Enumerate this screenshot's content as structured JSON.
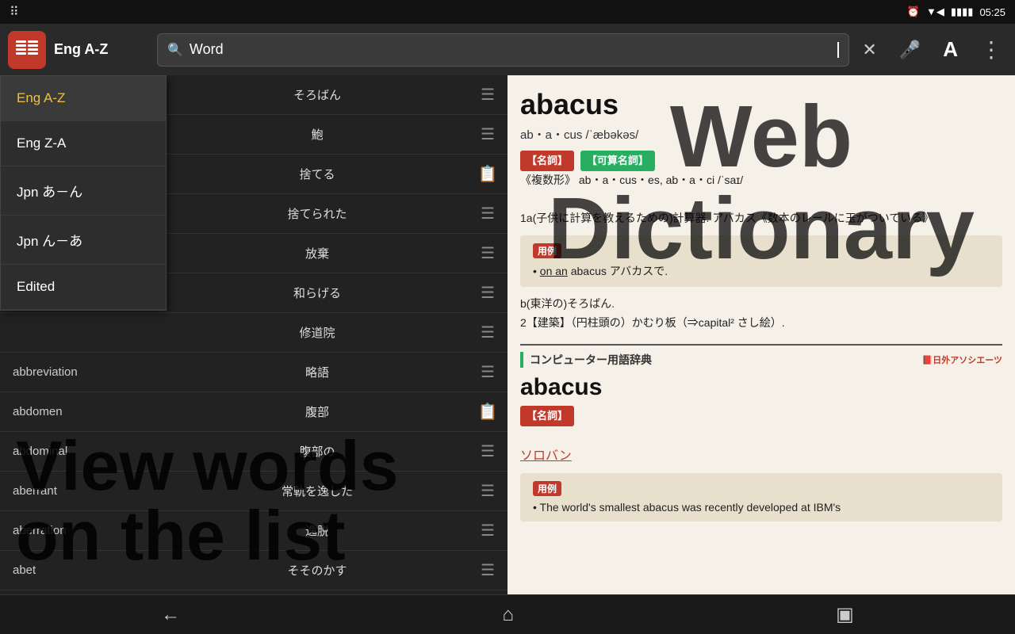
{
  "statusBar": {
    "gridIcon": "⠿",
    "alarmIcon": "⏰",
    "wifiIcon": "▼",
    "batteryIcon": "🔋",
    "time": "05:25"
  },
  "topBar": {
    "sortLabel": "Eng A-Z",
    "searchPlaceholder": "Word",
    "searchValue": "Word"
  },
  "dropdown": {
    "items": [
      {
        "label": "Eng A-Z",
        "active": true
      },
      {
        "label": "Eng Z-A",
        "active": false
      },
      {
        "label": "Jpn あ－ん",
        "active": false
      },
      {
        "label": "Jpn ん－あ",
        "active": false
      },
      {
        "label": "Edited",
        "active": false
      }
    ]
  },
  "wordList": {
    "rows": [
      {
        "en": "",
        "jp": "そろばん",
        "icon": "list"
      },
      {
        "en": "",
        "jp": "鮑",
        "icon": "list"
      },
      {
        "en": "",
        "jp": "捨てる",
        "icon": "list-active"
      },
      {
        "en": "",
        "jp": "捨てられた",
        "icon": "list"
      },
      {
        "en": "",
        "jp": "放棄",
        "icon": "list"
      },
      {
        "en": "",
        "jp": "和らげる",
        "icon": "list"
      },
      {
        "en": "",
        "jp": "修道院",
        "icon": "list"
      },
      {
        "en": "abbreviation",
        "jp": "略語",
        "icon": "list"
      },
      {
        "en": "abdomen",
        "jp": "腹部",
        "icon": "list-active"
      },
      {
        "en": "abdominal",
        "jp": "腹部の",
        "icon": "list"
      },
      {
        "en": "aberrant",
        "jp": "常軌を逸した",
        "icon": "list"
      },
      {
        "en": "aberration",
        "jp": "逸脱",
        "icon": "list"
      },
      {
        "en": "abet",
        "jp": "そそのかす",
        "icon": "list"
      }
    ]
  },
  "dictionary": {
    "mainEntry": {
      "word": "abacus",
      "pronunciation": "ab・a・cus /ˈæbəkəs/",
      "badge1": "【名詞】",
      "badge2": "【可算名詞】",
      "plural": "《複数形》 ab・a・cus・es, ab・a・ci /ˈsaɪ/",
      "def1": "1a(子供に計算を教えるための)計算器. アバカス《数本のレールに玉がついている》",
      "exampleLabel": "用例",
      "example1Link": "on an",
      "example1Word": "abacus",
      "example1Jp": "アバカスで.",
      "def2b": "b(東洋の)そろばん.",
      "def2": "2【建築】（円柱頭の）かむり板（⇒capital² さし絵）."
    },
    "computerSection": {
      "sectionTitle": "コンピューター用語辞典",
      "sectionLogo": "📕日外アソシエーツ",
      "word": "abacus",
      "badge": "【名詞】",
      "jp": "ソロバン",
      "exampleLabel": "用例",
      "example": "The world's smallest abacus was recently developed at IBM's"
    }
  },
  "promoLeft": {
    "line1": "View words",
    "line2": "on the list"
  },
  "promoRight": {
    "line1": "Web",
    "line2": "Dictionary"
  },
  "bottomNav": {
    "back": "←",
    "home": "⌂",
    "recents": "▣"
  }
}
